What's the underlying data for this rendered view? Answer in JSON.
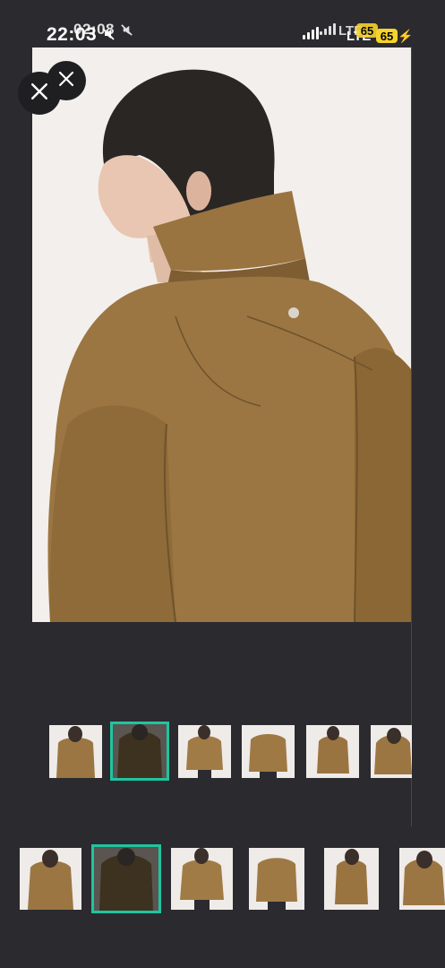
{
  "status_bar": {
    "time_primary": "22:03",
    "time_ghost": "02:08",
    "network": "LTE",
    "network_ghost": "LTE",
    "battery": "65",
    "battery_ghost": "65"
  },
  "viewer": {
    "close_icon": "close-icon",
    "image_subject": "Tan / olive utility jacket with high collar, back view on model",
    "selected_thumbnail_index": 1,
    "thumbnail_count_strip_top": 6,
    "thumbnail_count_strip_bottom": 6
  },
  "colors": {
    "background": "#2b2a2f",
    "selected_border": "#1ec5a0",
    "jacket_tan": "#9a7440",
    "jacket_dark": "#3c321f"
  }
}
